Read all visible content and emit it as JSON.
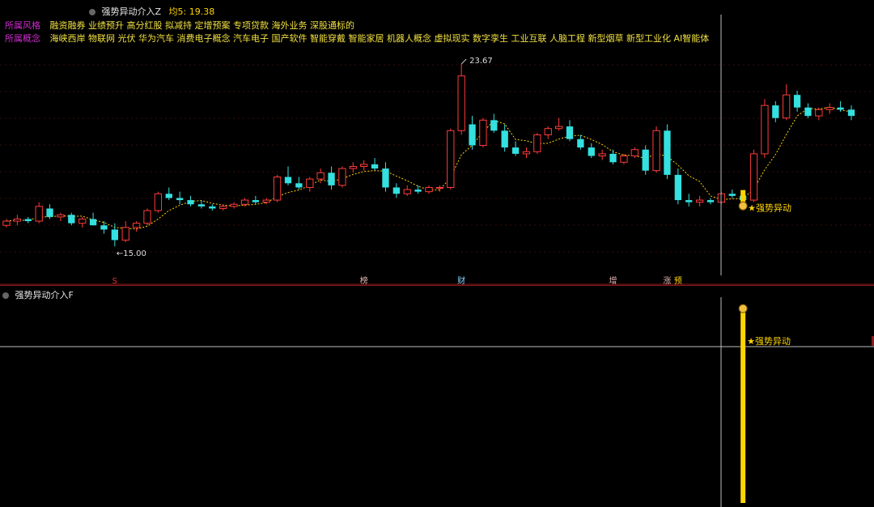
{
  "header": {
    "indicator_name": "强势异动介入Z",
    "avg_label": "均5: 19.38"
  },
  "concepts": {
    "style_label": "所属风格",
    "style_items": "融资融券 业绩预升 高分红股 拟减持 定增预案 专项贷款 海外业务 深股通标的",
    "concept_label": "所属概念",
    "concept_items": "海峡西岸 物联网 光伏 华为汽车 消费电子概念 汽车电子 国产软件 智能穿戴 智能家居 机器人概念 虚拟现实 数字孪生 工业互联 人脑工程 新型烟草 新型工业化 AI智能体"
  },
  "lower_panel": {
    "indicator_name": "强势异动介入F",
    "signal_label": "★强势异动"
  },
  "annotations": {
    "high_label": "23.67",
    "low_label": "←15.00",
    "signal_label": "★强势异动"
  },
  "event_marks": [
    {
      "label": "S",
      "index": 10,
      "color": "#e03030"
    },
    {
      "label": "榜",
      "index": 33,
      "color": "#e0b0b0"
    },
    {
      "label": "财",
      "index": 42,
      "color": "#7fd4ff"
    },
    {
      "label": "增",
      "index": 56,
      "color": "#e0b0b0"
    },
    {
      "label": "涨",
      "index": 61,
      "color": "#e0b0b0"
    },
    {
      "label": "预",
      "index": 62,
      "color": "#ffd400"
    }
  ],
  "colors": {
    "up": "#ff3b3b",
    "down": "#34e0e0",
    "ma": "#ffd400",
    "signal": "#ffd400",
    "crosshair": "#bbbbbb"
  },
  "chart_data": {
    "type": "candlestick",
    "ylim": [
      14.2,
      24.4
    ],
    "ohlc": [
      [
        16.0,
        16.3,
        15.9,
        16.2
      ],
      [
        16.2,
        16.5,
        16.0,
        16.3
      ],
      [
        16.3,
        16.4,
        16.1,
        16.2
      ],
      [
        16.2,
        17.1,
        16.1,
        16.9
      ],
      [
        16.8,
        17.0,
        16.3,
        16.4
      ],
      [
        16.4,
        16.6,
        16.2,
        16.5
      ],
      [
        16.5,
        16.6,
        16.0,
        16.1
      ],
      [
        16.1,
        16.4,
        15.9,
        16.3
      ],
      [
        16.3,
        16.6,
        16.0,
        16.0
      ],
      [
        16.0,
        16.2,
        15.6,
        15.8
      ],
      [
        15.8,
        16.1,
        15.0,
        15.3
      ],
      [
        15.3,
        16.2,
        15.2,
        15.9
      ],
      [
        15.9,
        16.2,
        15.7,
        16.1
      ],
      [
        16.1,
        16.8,
        16.0,
        16.7
      ],
      [
        16.7,
        17.6,
        16.6,
        17.5
      ],
      [
        17.5,
        17.8,
        17.2,
        17.3
      ],
      [
        17.3,
        17.6,
        17.0,
        17.2
      ],
      [
        17.2,
        17.4,
        16.9,
        17.0
      ],
      [
        17.0,
        17.2,
        16.8,
        16.9
      ],
      [
        16.9,
        17.0,
        16.7,
        16.8
      ],
      [
        16.8,
        17.0,
        16.7,
        16.9
      ],
      [
        16.9,
        17.1,
        16.8,
        17.0
      ],
      [
        17.0,
        17.3,
        16.9,
        17.2
      ],
      [
        17.2,
        17.4,
        17.0,
        17.1
      ],
      [
        17.1,
        17.3,
        17.0,
        17.2
      ],
      [
        17.2,
        18.4,
        17.1,
        18.3
      ],
      [
        18.3,
        18.8,
        17.9,
        18.0
      ],
      [
        18.0,
        18.3,
        17.7,
        17.8
      ],
      [
        17.8,
        18.3,
        17.6,
        18.2
      ],
      [
        18.2,
        18.7,
        18.0,
        18.5
      ],
      [
        18.5,
        18.8,
        17.7,
        17.9
      ],
      [
        17.9,
        18.8,
        17.8,
        18.7
      ],
      [
        18.7,
        19.0,
        18.5,
        18.8
      ],
      [
        18.8,
        19.1,
        18.6,
        18.9
      ],
      [
        18.9,
        19.2,
        18.6,
        18.7
      ],
      [
        18.7,
        19.0,
        17.6,
        17.8
      ],
      [
        17.8,
        18.0,
        17.3,
        17.5
      ],
      [
        17.5,
        17.9,
        17.4,
        17.7
      ],
      [
        17.7,
        17.9,
        17.5,
        17.6
      ],
      [
        17.6,
        17.9,
        17.5,
        17.8
      ],
      [
        17.8,
        17.9,
        17.6,
        17.8
      ],
      [
        17.8,
        20.6,
        17.7,
        20.5
      ],
      [
        20.5,
        23.67,
        20.3,
        23.1
      ],
      [
        20.8,
        21.2,
        19.6,
        19.8
      ],
      [
        19.8,
        21.1,
        19.7,
        21.0
      ],
      [
        21.0,
        21.3,
        20.4,
        20.5
      ],
      [
        20.5,
        20.8,
        19.5,
        19.7
      ],
      [
        19.7,
        20.0,
        19.3,
        19.4
      ],
      [
        19.4,
        19.7,
        19.2,
        19.5
      ],
      [
        19.5,
        20.4,
        19.4,
        20.3
      ],
      [
        20.3,
        20.7,
        20.1,
        20.6
      ],
      [
        20.6,
        21.1,
        20.5,
        20.7
      ],
      [
        20.7,
        21.0,
        20.0,
        20.1
      ],
      [
        20.1,
        20.3,
        19.6,
        19.7
      ],
      [
        19.7,
        19.9,
        19.2,
        19.3
      ],
      [
        19.3,
        19.6,
        19.1,
        19.4
      ],
      [
        19.4,
        19.6,
        18.9,
        19.0
      ],
      [
        19.0,
        19.4,
        18.9,
        19.3
      ],
      [
        19.3,
        19.7,
        19.2,
        19.6
      ],
      [
        19.6,
        19.8,
        18.4,
        18.6
      ],
      [
        18.6,
        20.7,
        18.5,
        20.5
      ],
      [
        20.5,
        20.8,
        18.2,
        18.4
      ],
      [
        18.4,
        18.7,
        17.0,
        17.2
      ],
      [
        17.2,
        17.5,
        16.9,
        17.1
      ],
      [
        17.1,
        17.4,
        16.9,
        17.2
      ],
      [
        17.2,
        17.3,
        17.0,
        17.1
      ],
      [
        17.1,
        17.6,
        17.0,
        17.5
      ],
      [
        17.5,
        17.7,
        17.3,
        17.4
      ],
      [
        17.4,
        17.6,
        17.0,
        17.2
      ],
      [
        17.2,
        19.6,
        17.1,
        19.4
      ],
      [
        19.4,
        22.0,
        19.2,
        21.7
      ],
      [
        21.7,
        21.9,
        20.9,
        21.1
      ],
      [
        21.1,
        22.7,
        21.0,
        22.2
      ],
      [
        22.2,
        22.4,
        21.4,
        21.6
      ],
      [
        21.6,
        21.8,
        21.1,
        21.2
      ],
      [
        21.2,
        21.6,
        21.0,
        21.5
      ],
      [
        21.5,
        21.8,
        21.3,
        21.6
      ],
      [
        21.6,
        21.9,
        21.4,
        21.5
      ],
      [
        21.5,
        21.7,
        21.0,
        21.2
      ]
    ],
    "ma5_value": 19.38,
    "signal_index": 68
  }
}
